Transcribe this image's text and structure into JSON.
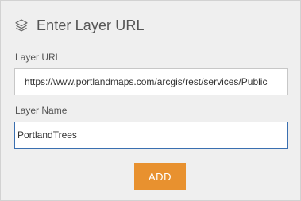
{
  "header": {
    "icon": "layers-icon",
    "title": "Enter Layer URL"
  },
  "form": {
    "url_label": "Layer URL",
    "url_value": "https://www.portlandmaps.com/arcgis/rest/services/Public",
    "name_label": "Layer Name",
    "name_value": "PortlandTrees"
  },
  "actions": {
    "add_label": "ADD"
  },
  "colors": {
    "panel_bg": "#efefef",
    "accent": "#e8912f",
    "focus_border": "#3a6fb0"
  }
}
